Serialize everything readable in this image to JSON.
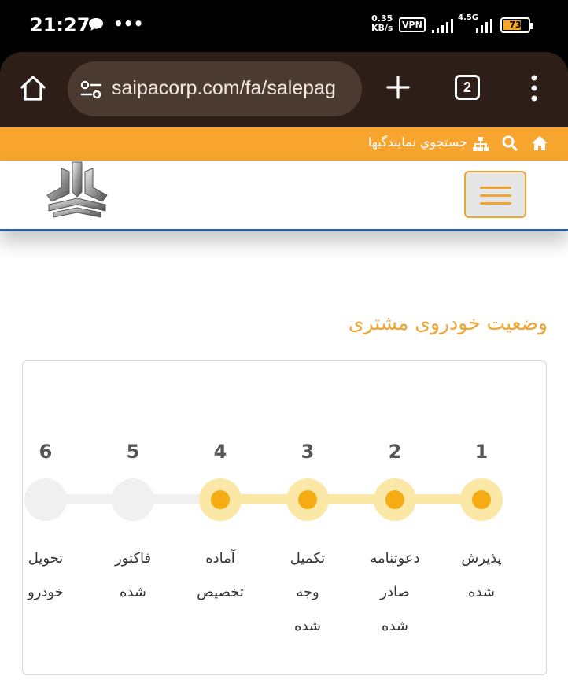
{
  "status_bar": {
    "time": "21:27",
    "speed_value": "0.35",
    "speed_unit": "KB/s",
    "vpn": "VPN",
    "network": "4.5G",
    "battery": "73",
    "battery_fraction": 0.73
  },
  "browser": {
    "url": "saipacorp.com/fa/salepag",
    "tab_count": "2"
  },
  "site_topbar": {
    "dealer_search_link": "جستجوي نمايندگيها",
    "accent_color": "#f7a52e"
  },
  "page": {
    "section_title": "وضعیت خودروی مشتری",
    "steps": [
      {
        "number": "1",
        "label_lines": [
          "پذیرش",
          "شده"
        ],
        "completed": true
      },
      {
        "number": "2",
        "label_lines": [
          "دعوتنامه",
          "صادر",
          "شده"
        ],
        "completed": true
      },
      {
        "number": "3",
        "label_lines": [
          "تکمیل",
          "وجه",
          "شده"
        ],
        "completed": true
      },
      {
        "number": "4",
        "label_lines": [
          "آماده",
          "تخصیص"
        ],
        "completed": true
      },
      {
        "number": "5",
        "label_lines": [
          "فاکتور",
          "شده"
        ],
        "completed": false
      },
      {
        "number": "6",
        "label_lines": [
          "تحویل",
          "خودرو"
        ],
        "completed": false
      }
    ]
  },
  "icons": {
    "browser_home": "home-icon",
    "site_settings": "site-settings-icon",
    "new_tab": "plus-icon",
    "menu": "more-vert-icon",
    "site_home": "home-icon",
    "site_search": "search-icon",
    "site_sitemap": "sitemap-icon",
    "hamburger": "hamburger-icon",
    "logo": "saipa-logo"
  }
}
